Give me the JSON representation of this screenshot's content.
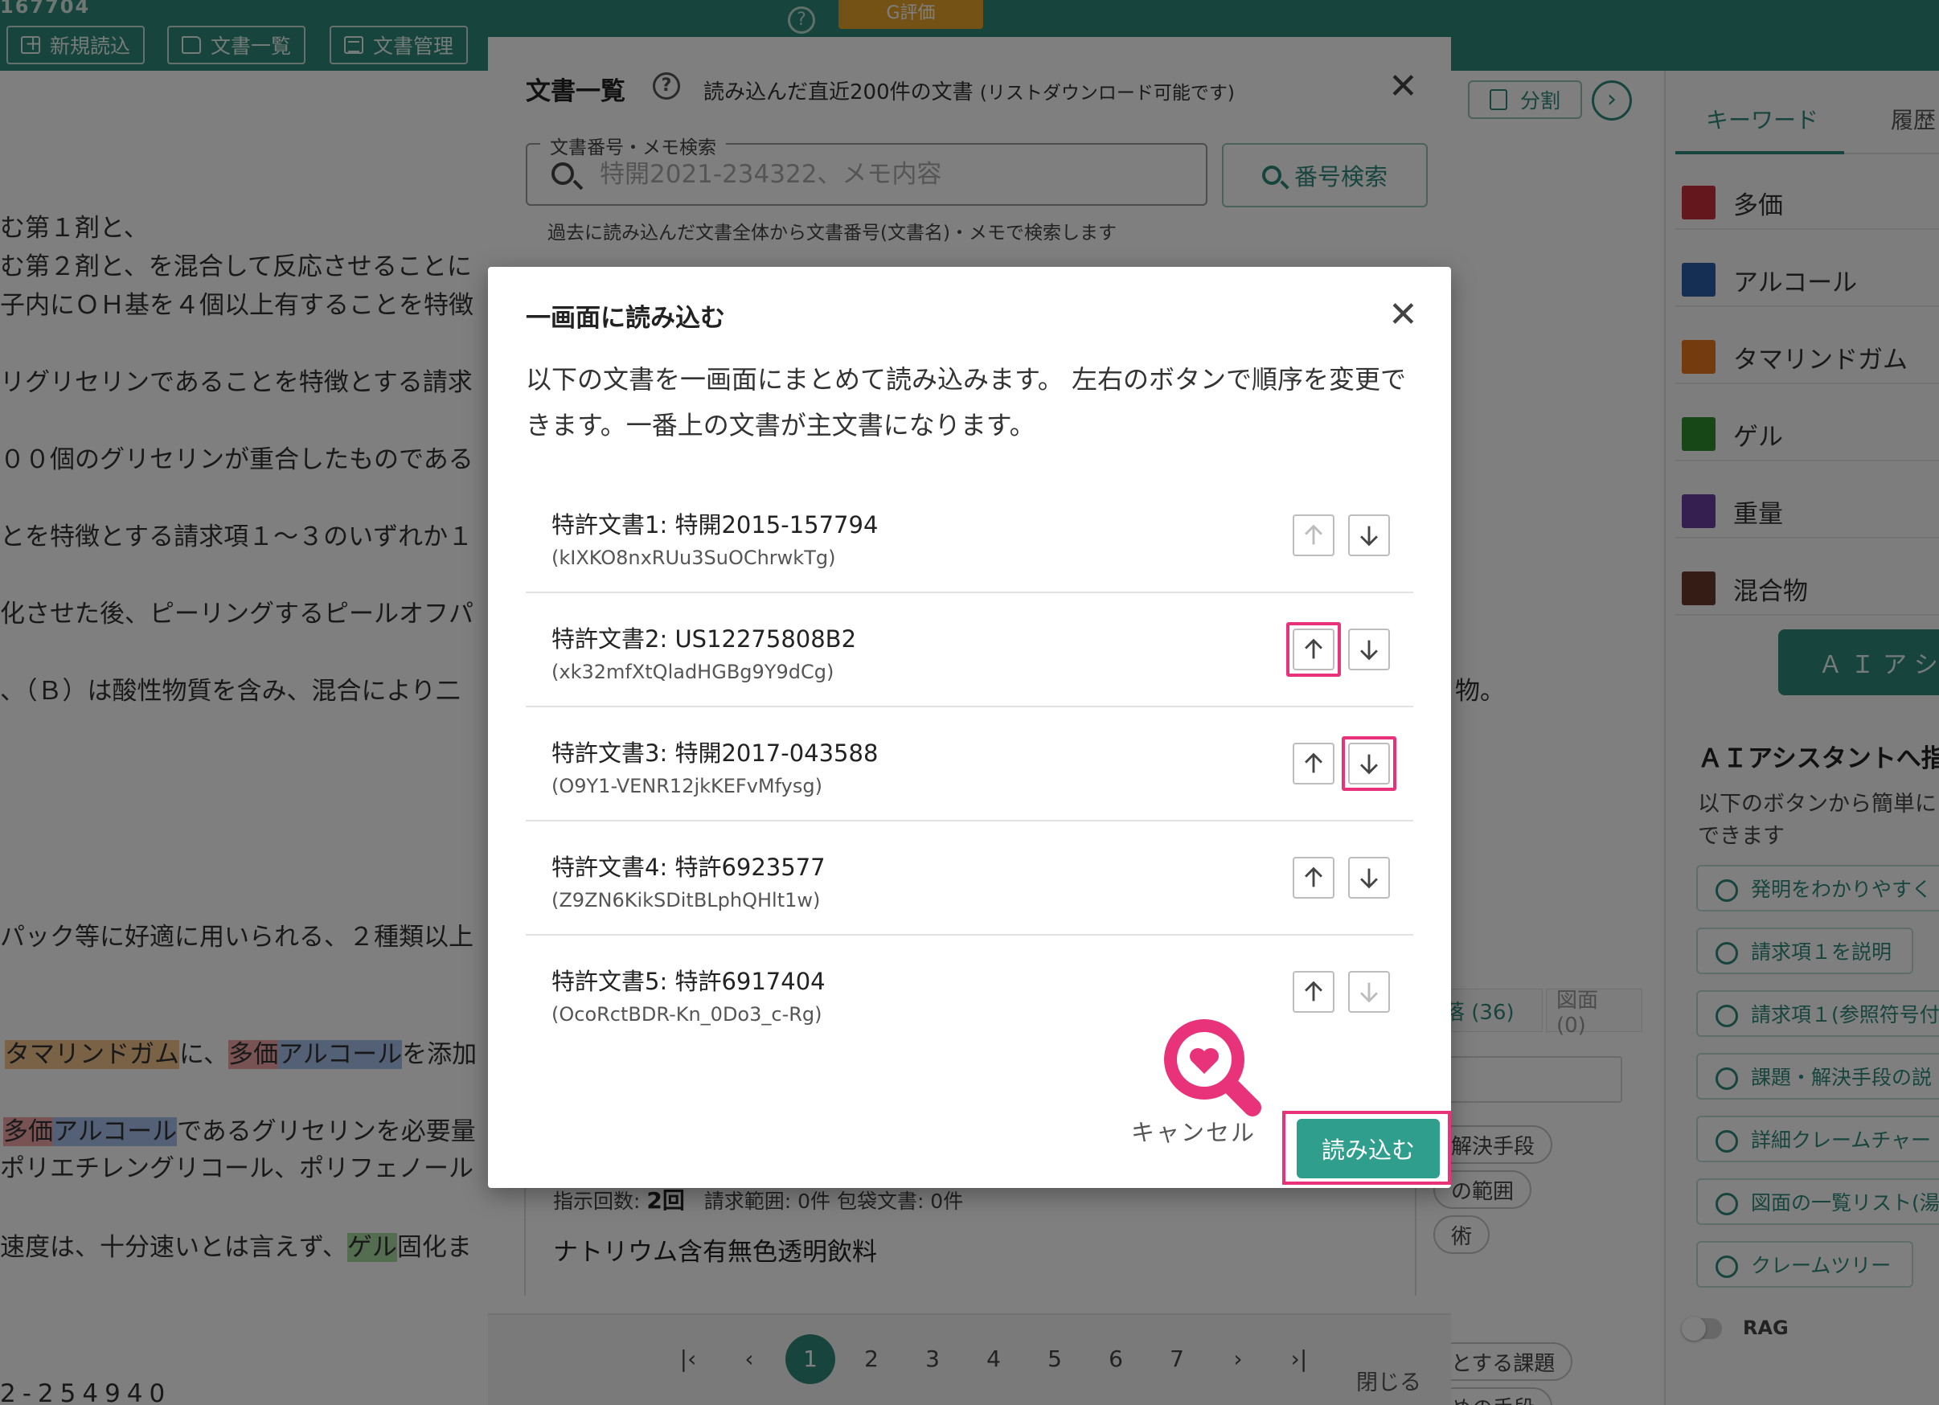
{
  "topbar": {
    "doc_number": "167704",
    "buttons": [
      "新規読込",
      "文書一覧",
      "文書管理"
    ],
    "g_eval": "G評価"
  },
  "background_doc": {
    "split_label": "分割",
    "lines": [
      "む第１剤と、",
      "む第２剤と、を混合して反応させることに",
      "子内にＯＨ基を４個以上有することを特徴",
      "リグリセリンであることを特徴とする請求",
      "００個のグリセリンが重合したものである",
      "とを特徴とする請求項１～３のいずれか１",
      "化させた後、ピーリングするピールオフパ",
      "、（Ｂ）は酸性物質を含み、混合により二",
      "パック等に好適に用いられる、２種類以上",
      "ポリエチレングリコール、ポリフェノール",
      "2-254940"
    ],
    "line_tail": "物。",
    "hl_line1": {
      "a": "タマリンドガム",
      "b": "に、",
      "c": "多価",
      "d": "アルコール",
      "e": "を添加"
    },
    "hl_line2": {
      "a": "多価",
      "b": "アルコール",
      "c": "であるグリセリンを必要量"
    },
    "hl_line3": {
      "a": "速度は、十分速いとは言えず、",
      "b": "ゲル",
      "c": "固化ま"
    }
  },
  "right_panel": {
    "tab_keyword": "キーワード",
    "tab_history": "履歴",
    "keywords": [
      {
        "label": "多価",
        "color": "#c8303a"
      },
      {
        "label": "アルコール",
        "color": "#2b5fa8"
      },
      {
        "label": "タマリンドガム",
        "color": "#e8771e"
      },
      {
        "label": "ゲル",
        "color": "#2f8f2f"
      },
      {
        "label": "重量",
        "color": "#6a3fa0"
      },
      {
        "label": "混合物",
        "color": "#6b3a2a"
      }
    ],
    "ai_button": "ＡＩアシ",
    "ai_title": "ＡＩアシスタントへ指",
    "ai_desc1": "以下のボタンから簡単に",
    "ai_desc2": "できます",
    "ai_chips": [
      "発明をわかりやすく",
      "請求項１を説明",
      "請求項１(参照符号付",
      "課題・解決手段の説",
      "詳細クレームチャー",
      "図面の一覧リスト(湯",
      "クレームツリー"
    ],
    "rag_label": "RAG"
  },
  "outer_dialog": {
    "title": "文書一覧",
    "subtitle": "読み込んだ直近200件の文書",
    "subtitle_note": "(リストダウンロード可能です)",
    "search_legend": "文書番号・メモ検索",
    "search_placeholder": "特開2021-234322、メモ内容",
    "number_search": "番号検索",
    "hint": "過去に読み込んだ文書全体から文書番号(文書名)・メモで検索します",
    "tab_para": "落 (36)",
    "tab_fig": "図面 (0)",
    "chips": [
      "解決手段",
      "の範囲",
      "術",
      "とする課題",
      "めの手段"
    ],
    "meta_label_count": "指示回数:",
    "meta_count": "2回",
    "meta_claims": "請求範囲: 0件 包袋文書: 0件",
    "card_title": "ナトリウム含有無色透明飲料",
    "pages": [
      "1",
      "2",
      "3",
      "4",
      "5",
      "6",
      "7"
    ],
    "close_label": "閉じる"
  },
  "modal": {
    "title": "一画面に読み込む",
    "description": "以下の文書を一画面にまとめて読み込みます。 左右のボタンで順序を変更できます。一番上の文書が主文書になります。",
    "documents": [
      {
        "name": "特許文書1: 特開2015-157794",
        "id": "(kIXKO8nxRUu3SuOChrwkTg)"
      },
      {
        "name": "特許文書2: US12275808B2",
        "id": "(xk32mfXtQladHGBg9Y9dCg)"
      },
      {
        "name": "特許文書3: 特開2017-043588",
        "id": "(O9Y1-VENR12jkKEFvMfysg)"
      },
      {
        "name": "特許文書4: 特許6923577",
        "id": "(Z9ZN6KikSDitBLphQHlt1w)"
      },
      {
        "name": "特許文書5: 特許6917404",
        "id": "(OcoRctBDR-Kn_0Do3_c-Rg)"
      }
    ],
    "cancel_label": "キャンセル",
    "load_label": "読み込む",
    "accent_color": "#2f9e8c",
    "highlight_color": "#e8327a"
  }
}
